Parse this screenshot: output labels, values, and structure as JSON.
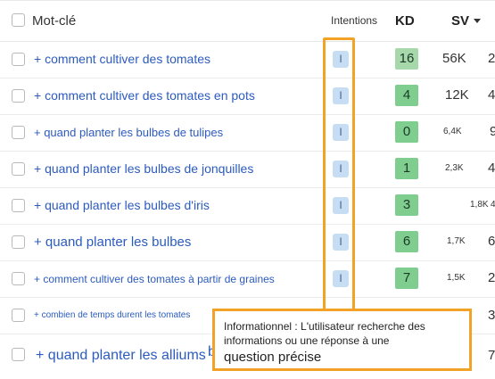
{
  "header": {
    "keyword": "Mot-clé",
    "intentions": "Intentions",
    "kd": "KD",
    "sv": "SV"
  },
  "rows": [
    {
      "keyword": "+ comment cultiver des tomates",
      "intent": "I",
      "kd": "16",
      "kd_color": "#a7d8ab",
      "sv": "56K",
      "extra": "2"
    },
    {
      "keyword": "+ comment cultiver des tomates en pots",
      "intent": "I",
      "kd": "4",
      "kd_color": "#7fcd8f",
      "sv": "12K",
      "extra": "4"
    },
    {
      "keyword": "+ quand planter les bulbes de tulipes",
      "intent": "I",
      "kd": "0",
      "kd_color": "#7fcd8f",
      "sv": "6,4K",
      "extra": "9"
    },
    {
      "keyword": "+ quand planter les bulbes de jonquilles",
      "intent": "I",
      "kd": "1",
      "kd_color": "#7fcd8f",
      "sv": "2,3K",
      "extra": "4"
    },
    {
      "keyword": "+ quand planter les bulbes d'iris",
      "intent": "I",
      "kd": "3",
      "kd_color": "#7fcd8f",
      "sv": "1,8K",
      "extra": "4"
    },
    {
      "keyword": "+ quand planter les bulbes",
      "intent": "I",
      "kd": "6",
      "kd_color": "#7fcd8f",
      "sv": "1,7K",
      "extra": "6"
    },
    {
      "keyword": "+ comment cultiver des tomates à partir de graines",
      "intent": "I",
      "kd": "7",
      "kd_color": "#7fcd8f",
      "sv": "1,5K",
      "extra": "2"
    },
    {
      "keyword": "+ combien de temps durent les tomates",
      "extra": "3"
    },
    {
      "keyword": "+ quand planter les alliums",
      "keyword_cut": "b",
      "extra": "7"
    }
  ],
  "tooltip": {
    "line1": "Informationnel : L'utilisateur recherche des",
    "line2": "informations ou une réponse à une",
    "line3": "question précise"
  },
  "colors": {
    "highlight": "#f2a226",
    "link": "#2c5bbf",
    "intent_badge": "#c6ddf3",
    "kd_easy": "#7fcd8f",
    "kd_low": "#a7d8ab"
  }
}
